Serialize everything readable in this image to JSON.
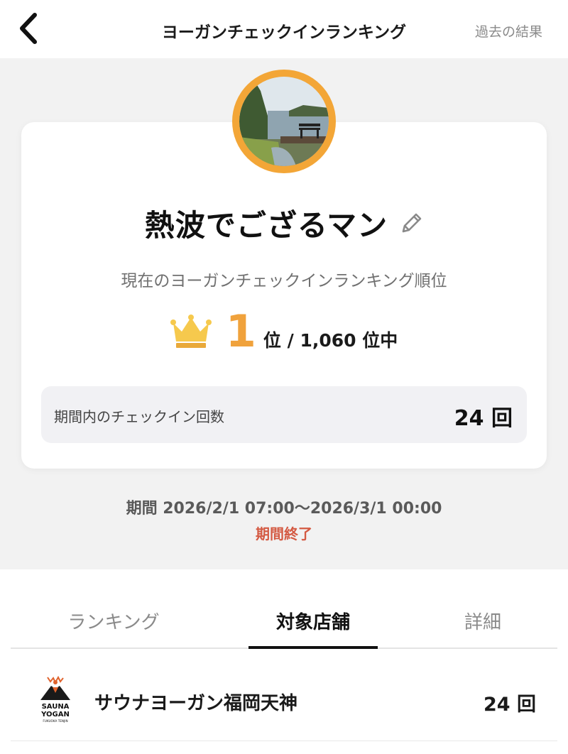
{
  "header": {
    "title": "ヨーガンチェックインランキング",
    "past_results": "過去の結果",
    "back_icon": "chevron-left-icon"
  },
  "profile": {
    "username": "熱波でござるマン",
    "edit_icon": "pencil-icon",
    "avatar_description": "lake-bench-photo"
  },
  "ranking": {
    "caption": "現在のヨーガンチェックインランキング順位",
    "rank": "1",
    "suffix": "位 / 1,060 位中",
    "crown_icon": "crown-icon",
    "accent_color": "#f0a23c"
  },
  "checkins": {
    "label": "期間内のチェックイン回数",
    "count": "24 回"
  },
  "period": {
    "text": "期間 2026/2/1 07:00～2026/3/1 00:00",
    "status": "期間終了",
    "status_color": "#d45a43"
  },
  "tabs": [
    {
      "label": "ランキング",
      "active": false
    },
    {
      "label": "対象店舗",
      "active": true
    },
    {
      "label": "詳細",
      "active": false
    }
  ],
  "stores": [
    {
      "name": "サウナヨーガン福岡天神",
      "count": "24 回",
      "logo_text": [
        "SAUNA",
        "YOGAN",
        "FUKUOKA TENJIN"
      ]
    }
  ]
}
